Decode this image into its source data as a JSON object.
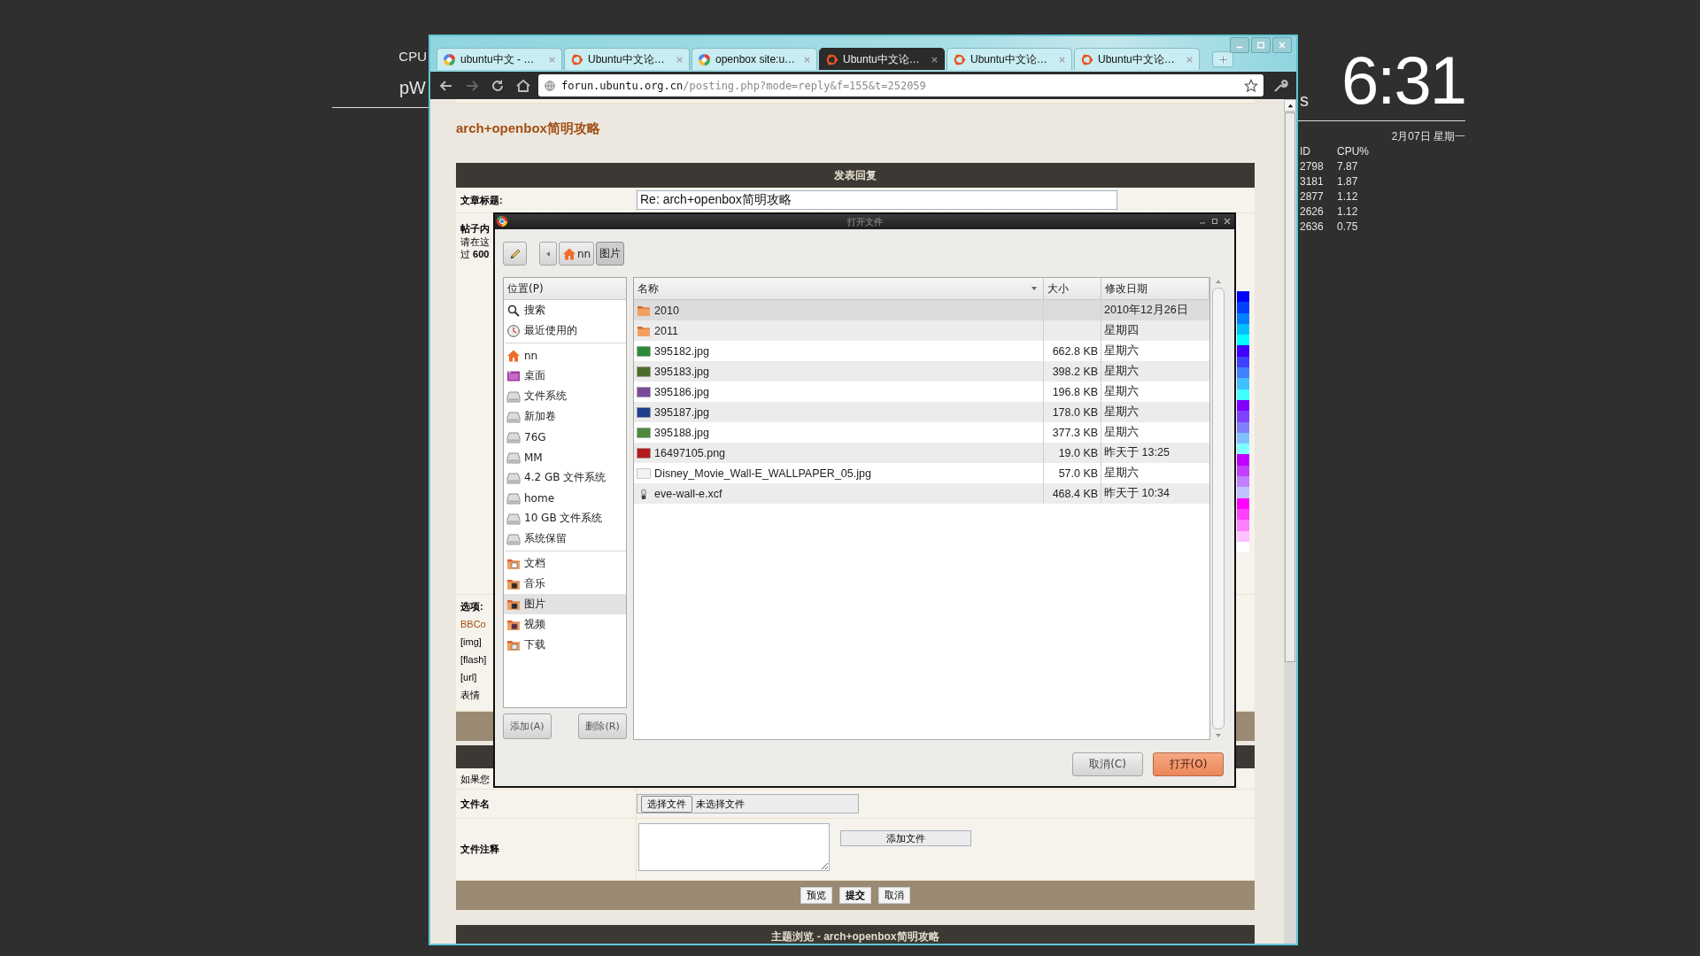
{
  "desktop": {
    "left_labels": [
      "CPU",
      "pW"
    ],
    "cut_text": "s",
    "clock": "6:31",
    "date": "2月07日 星期一",
    "process_table": {
      "columns": [
        "ID",
        "CPU%"
      ],
      "rows": [
        [
          "2798",
          "7.87"
        ],
        [
          "3181",
          "1.87"
        ],
        [
          "2877",
          "1.12"
        ],
        [
          "2626",
          "1.12"
        ],
        [
          "2636",
          "0.75"
        ]
      ]
    }
  },
  "browser": {
    "tabs": [
      {
        "title": "ubuntu中文 - …",
        "kind": "google",
        "selected": false
      },
      {
        "title": "Ubuntu中文论…",
        "kind": "ubuntu",
        "selected": false
      },
      {
        "title": "openbox site:u…",
        "kind": "google",
        "selected": false
      },
      {
        "title": "Ubuntu中文论…",
        "kind": "ubuntu",
        "selected": true
      },
      {
        "title": "Ubuntu中文论…",
        "kind": "ubuntu",
        "selected": false
      },
      {
        "title": "Ubuntu中文论…",
        "kind": "ubuntu",
        "selected": false
      }
    ],
    "address": {
      "host": "forun.ubuntu.org.cn",
      "path": "/posting.php?mode=reply&f=155&t=252059"
    }
  },
  "page": {
    "title": "arch+openbox简明攻略",
    "reply_header": "发表回复",
    "subject": {
      "label": "文章标题:",
      "value": "Re: arch+openbox简明攻略"
    },
    "body_label": {
      "title": "帖子内",
      "lines": [
        "请在这",
        "过 **600**"
      ]
    },
    "palette": [
      {
        "color": "#0000ff"
      },
      {
        "color": "#0040ff"
      },
      {
        "color": "#0080ff"
      },
      {
        "color": "#00c0ff"
      },
      {
        "color": "#00ffff"
      },
      {
        "color": "#4000ff"
      },
      {
        "color": "#4040ff"
      },
      {
        "color": "#4080ff"
      },
      {
        "color": "#40c0ff"
      },
      {
        "color": "#40ffff"
      },
      {
        "color": "#8000ff"
      },
      {
        "color": "#8040ff"
      },
      {
        "color": "#8080ff"
      },
      {
        "color": "#80c0ff"
      },
      {
        "color": "#80ffff"
      },
      {
        "color": "#c000ff"
      },
      {
        "color": "#c040ff"
      },
      {
        "color": "#c080ff"
      },
      {
        "color": "#c0c0ff"
      },
      {
        "color": "#ff00ff"
      },
      {
        "color": "#ff40ff"
      },
      {
        "color": "#ff80ff"
      },
      {
        "color": "#ffc0ff"
      },
      {
        "color": "#ffffff"
      }
    ],
    "options": {
      "label": "选项:",
      "lines": [
        {
          "text": "BBCo",
          "kind": "link"
        },
        {
          "text": "[img]",
          "kind": "text"
        },
        {
          "text": "[flash]",
          "kind": "text"
        },
        {
          "text": "[url]",
          "kind": "text"
        },
        {
          "text": "表情",
          "kind": "text"
        }
      ]
    },
    "attach_hint": "如果您",
    "file_row": {
      "label": "文件名",
      "button": "选择文件",
      "status": "未选择文件"
    },
    "comment_row": {
      "label": "文件注释",
      "add_button": "添加文件"
    },
    "actions": [
      {
        "label": "预览",
        "primary": false
      },
      {
        "label": "提交",
        "primary": true
      },
      {
        "label": "取消",
        "primary": false
      }
    ],
    "footer": "主题浏览 - arch+openbox简明攻略"
  },
  "dialog": {
    "title": "打开文件",
    "path": [
      {
        "label": "nn",
        "kind": "home",
        "selected": false
      },
      {
        "label": "图片",
        "kind": "folder",
        "selected": true
      }
    ],
    "places_header": "位置(P)",
    "places": [
      {
        "items": [
          {
            "label": "搜索",
            "kind": "search",
            "selected": false
          },
          {
            "label": "最近使用的",
            "kind": "recent",
            "selected": false
          }
        ]
      },
      {
        "items": [
          {
            "label": "nn",
            "kind": "home",
            "selected": false
          },
          {
            "label": "桌面",
            "kind": "desktop",
            "selected": false
          },
          {
            "label": "文件系统",
            "kind": "drive",
            "selected": false
          },
          {
            "label": "新加卷",
            "kind": "drive",
            "selected": false
          },
          {
            "label": "76G",
            "kind": "drive",
            "selected": false
          },
          {
            "label": "MM",
            "kind": "drive",
            "selected": false
          },
          {
            "label": "4.2 GB 文件系统",
            "kind": "drive",
            "selected": false
          },
          {
            "label": "home",
            "kind": "drive",
            "selected": false
          },
          {
            "label": "10 GB 文件系统",
            "kind": "drive",
            "selected": false
          },
          {
            "label": "系统保留",
            "kind": "drive",
            "selected": false
          }
        ]
      },
      {
        "items": [
          {
            "label": "文档",
            "kind": "documents",
            "selected": false
          },
          {
            "label": "音乐",
            "kind": "music",
            "selected": false
          },
          {
            "label": "图片",
            "kind": "pictures",
            "selected": true
          },
          {
            "label": "视频",
            "kind": "videos",
            "selected": false
          },
          {
            "label": "下载",
            "kind": "downloads",
            "selected": false
          }
        ]
      }
    ],
    "add_button": "添加(A)",
    "remove_button": "删除(R)",
    "columns": [
      "名称",
      "大小",
      "修改日期"
    ],
    "files": [
      {
        "name": "2010",
        "kind": "folder",
        "modified": "2010年12月26日",
        "selected": true
      },
      {
        "name": "2011",
        "kind": "folder",
        "modified": "星期四",
        "selected": false
      },
      {
        "name": "395182.jpg",
        "kind": "image",
        "color": "#2e8a3a",
        "size": "662.8 KB",
        "modified": "星期六",
        "selected": false
      },
      {
        "name": "395183.jpg",
        "kind": "image",
        "color": "#4f6b2a",
        "size": "398.2 KB",
        "modified": "星期六",
        "selected": false
      },
      {
        "name": "395186.jpg",
        "kind": "image",
        "color": "#7a4a9a",
        "size": "196.8 KB",
        "modified": "星期六",
        "selected": false
      },
      {
        "name": "395187.jpg",
        "kind": "image",
        "color": "#1e3f8a",
        "size": "178.0 KB",
        "modified": "星期六",
        "selected": false
      },
      {
        "name": "395188.jpg",
        "kind": "image",
        "color": "#4e8a3e",
        "size": "377.3 KB",
        "modified": "星期六",
        "selected": false
      },
      {
        "name": "16497105.png",
        "kind": "image",
        "color": "#b41a1a",
        "size": "19.0 KB",
        "modified": "昨天于 13:25",
        "selected": false
      },
      {
        "name": "Disney_Movie_Wall-E_WALLPAPER_05.jpg",
        "kind": "image",
        "color": "#f2f2f2",
        "size": "57.0 KB",
        "modified": "星期六",
        "selected": false
      },
      {
        "name": "eve-wall-e.xcf",
        "kind": "file",
        "size": "468.4 KB",
        "modified": "昨天于 10:34",
        "selected": false
      }
    ],
    "buttons": [
      {
        "label": "取消(C)",
        "default": false
      },
      {
        "label": "打开(O)",
        "default": true
      }
    ]
  }
}
